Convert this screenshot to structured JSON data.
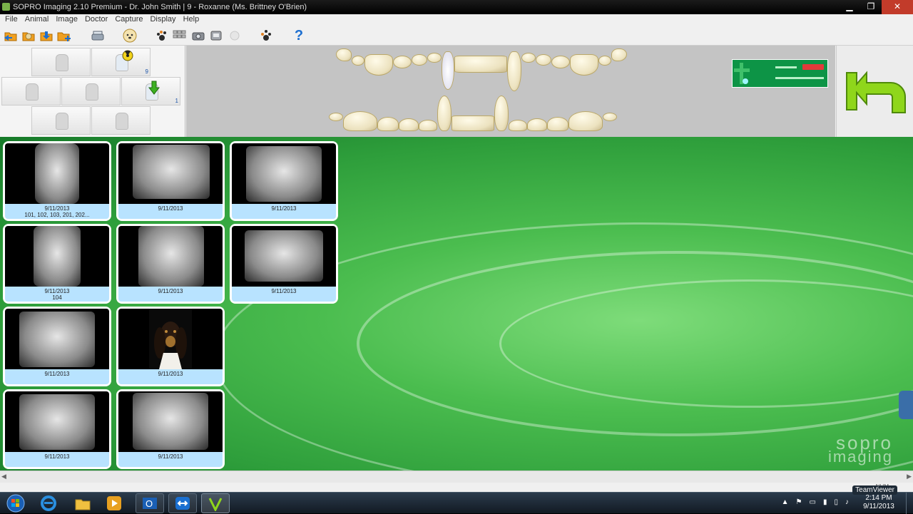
{
  "window": {
    "title": "SOPRO Imaging 2.10 Premium - Dr. John Smith | 9 - Roxanne (Ms. Brittney O'Brien)",
    "minimize": "▁",
    "restore": "❐",
    "close": "✕"
  },
  "menu": [
    "File",
    "Animal",
    "Image",
    "Doctor",
    "Capture",
    "Display",
    "Help"
  ],
  "toolbar_icons": [
    "folder-open-icon",
    "folder-settings-icon",
    "folder-import-icon",
    "folder-add-icon",
    "scanner-icon",
    "dog-face-icon",
    "paw-print-icon",
    "grid-view-icon",
    "camera-icon",
    "acquire-icon",
    "flash-icon",
    "paw-settings-icon",
    "help-icon"
  ],
  "help_glyph": "?",
  "capture_buttons": [
    {
      "count": ""
    },
    {
      "count": "9"
    },
    {
      "count": ""
    },
    {
      "count": ""
    },
    {
      "count": "1"
    },
    {
      "count": ""
    },
    {
      "count": ""
    }
  ],
  "thumbnails": [
    {
      "date": "9/11/2013",
      "teeth": "101, 102, 103, 201, 202..."
    },
    {
      "date": "9/11/2013",
      "teeth": ""
    },
    {
      "date": "9/11/2013",
      "teeth": ""
    },
    {
      "date": "9/11/2013",
      "teeth": "104"
    },
    {
      "date": "9/11/2013",
      "teeth": ""
    },
    {
      "date": "9/11/2013",
      "teeth": ""
    },
    {
      "date": "9/11/2013",
      "teeth": ""
    },
    {
      "date": "9/11/2013",
      "teeth": ""
    },
    {
      "date": "9/11/2013",
      "teeth": ""
    },
    {
      "date": "9/11/2013",
      "teeth": ""
    }
  ],
  "brand": {
    "line1": "sopro",
    "line2": "imaging"
  },
  "taskbar": {
    "apps": [
      "start-orb-icon",
      "internet-explorer-icon",
      "file-explorer-icon",
      "media-player-icon",
      "outlook-icon",
      "teamviewer-icon",
      "sopro-imaging-icon"
    ],
    "teamviewer_label": "TeamViewer",
    "num_label": "NUM",
    "time": "2:14 PM",
    "date": "9/11/2013"
  },
  "colors": {
    "accent_green": "#2e9e3b",
    "caption_blue": "#b8e3ff",
    "back_arrow": "#8fd61b"
  }
}
